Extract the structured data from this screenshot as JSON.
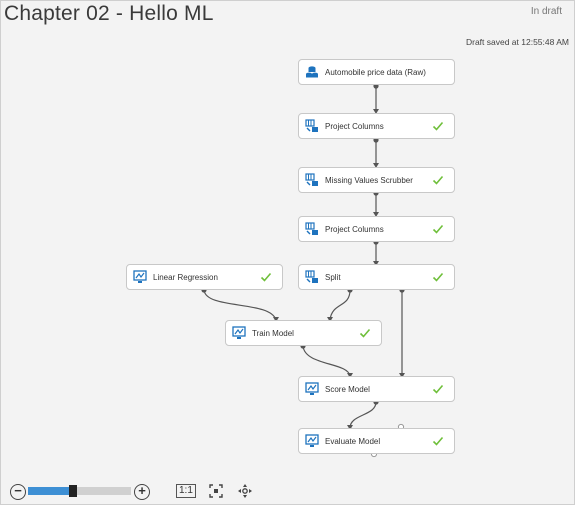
{
  "header": {
    "title": "Chapter 02 - Hello ML",
    "state": "In draft",
    "saved_status": "Draft saved at 12:55:48 AM"
  },
  "modules": [
    {
      "label": "Automobile price data (Raw)",
      "icon": "dataset-icon",
      "completed": false
    },
    {
      "label": "Project Columns",
      "icon": "transform-icon",
      "completed": true
    },
    {
      "label": "Missing Values Scrubber",
      "icon": "transform-icon",
      "completed": true
    },
    {
      "label": "Project Columns",
      "icon": "transform-icon",
      "completed": true
    },
    {
      "label": "Linear Regression",
      "icon": "model-icon",
      "completed": true
    },
    {
      "label": "Split",
      "icon": "transform-icon",
      "completed": true
    },
    {
      "label": "Train Model",
      "icon": "model-icon",
      "completed": true
    },
    {
      "label": "Score Model",
      "icon": "model-icon",
      "completed": true
    },
    {
      "label": "Evaluate Model",
      "icon": "model-icon",
      "completed": true
    }
  ],
  "toolbar": {
    "zoom_out_icon": "zoom-out-icon",
    "zoom_in_icon": "zoom-in-icon",
    "zoom_level": 0.44,
    "actual_size_label": "1:1",
    "fit_icon": "fit-to-screen-icon",
    "pan_icon": "pan-icon"
  },
  "colors": {
    "accent": "#3d8fd4",
    "check": "#6fbf3a",
    "icon_blue": "#1e73be"
  }
}
